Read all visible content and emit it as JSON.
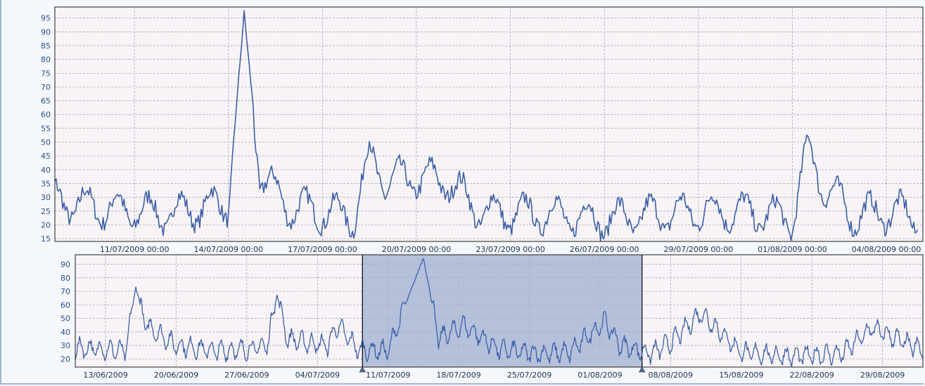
{
  "colors": {
    "series": "#3d5fa8",
    "plot_background": "#f8f3f7",
    "grid": "#9aa0a8",
    "selection_fill": "#9fb0d2",
    "axis_text": "#2b4f8e"
  },
  "chart_data": [
    {
      "type": "line",
      "role": "main-detail-chart",
      "title": "",
      "xlabel": "",
      "ylabel": "",
      "x_range": [
        "2009-07-08T11:00",
        "2009-08-05T04:00"
      ],
      "ylim": [
        14,
        99
      ],
      "yticks": [
        15,
        20,
        25,
        30,
        35,
        40,
        45,
        50,
        55,
        60,
        65,
        70,
        75,
        80,
        85,
        90,
        95
      ],
      "xtick_labels": [
        "11/07/2009 00:00",
        "14/07/2009 00:00",
        "17/07/2009 00:00",
        "20/07/2009 00:00",
        "23/07/2009 00:00",
        "26/07/2009 00:00",
        "29/07/2009 00:00",
        "01/08/2009 00:00",
        "04/08/2009 00:00"
      ],
      "grid": true,
      "series": [
        {
          "x": [
            "2009-07-08",
            "2009-07-09",
            "2009-07-10",
            "2009-07-11",
            "2009-07-12",
            "2009-07-13",
            "2009-07-14",
            "2009-07-14T12:00",
            "2009-07-15",
            "2009-07-16",
            "2009-07-17",
            "2009-07-18",
            "2009-07-18T12:00",
            "2009-07-19",
            "2009-07-20",
            "2009-07-21",
            "2009-07-22",
            "2009-07-23",
            "2009-07-24",
            "2009-07-25",
            "2009-07-26",
            "2009-07-27",
            "2009-07-28",
            "2009-07-29",
            "2009-07-30",
            "2009-07-31",
            "2009-08-01",
            "2009-08-01T12:00",
            "2009-08-02",
            "2009-08-03",
            "2009-08-04",
            "2009-08-05"
          ],
          "values": [
            30,
            28,
            26,
            25,
            24,
            26,
            28,
            97,
            38,
            26,
            25,
            23,
            45,
            36,
            37,
            36,
            25,
            24,
            24,
            23,
            22,
            23,
            24,
            25,
            25,
            24,
            22,
            48,
            34,
            23,
            25,
            23
          ]
        }
      ]
    },
    {
      "type": "line",
      "role": "overview-navigator-chart",
      "title": "",
      "xlabel": "",
      "ylabel": "",
      "x_range": [
        "2009-06-10",
        "2009-09-02"
      ],
      "ylim": [
        14,
        97
      ],
      "yticks": [
        20,
        30,
        40,
        50,
        60,
        70,
        80,
        90
      ],
      "xtick_labels": [
        "13/06/2009",
        "20/06/2009",
        "27/06/2009",
        "04/07/2009",
        "11/07/2009",
        "18/07/2009",
        "25/07/2009",
        "01/08/2009",
        "08/08/2009",
        "15/08/2009",
        "22/08/2009",
        "29/08/2009"
      ],
      "grid": true,
      "selection": {
        "from": "2009-07-08T11:00",
        "to": "2009-08-05T04:00"
      },
      "series": [
        {
          "x": [
            "2009-06-10",
            "2009-06-13",
            "2009-06-15",
            "2009-06-16",
            "2009-06-17",
            "2009-06-20",
            "2009-06-24",
            "2009-06-27",
            "2009-06-29",
            "2009-06-30",
            "2009-07-01",
            "2009-07-03",
            "2009-07-05",
            "2009-07-06",
            "2009-07-08",
            "2009-07-11",
            "2009-07-14T12:00",
            "2009-07-16",
            "2009-07-18T12:00",
            "2009-07-22",
            "2009-07-26",
            "2009-07-29",
            "2009-08-01T12:00",
            "2009-08-03",
            "2009-08-06",
            "2009-08-08",
            "2009-08-11",
            "2009-08-15",
            "2009-08-20",
            "2009-08-25",
            "2009-08-28",
            "2009-09-02"
          ],
          "values": [
            28,
            27,
            26,
            73,
            45,
            30,
            26,
            27,
            30,
            67,
            35,
            32,
            30,
            45,
            27,
            26,
            95,
            35,
            45,
            27,
            24,
            25,
            48,
            30,
            24,
            32,
            54,
            25,
            22,
            24,
            43,
            26
          ]
        }
      ]
    }
  ]
}
